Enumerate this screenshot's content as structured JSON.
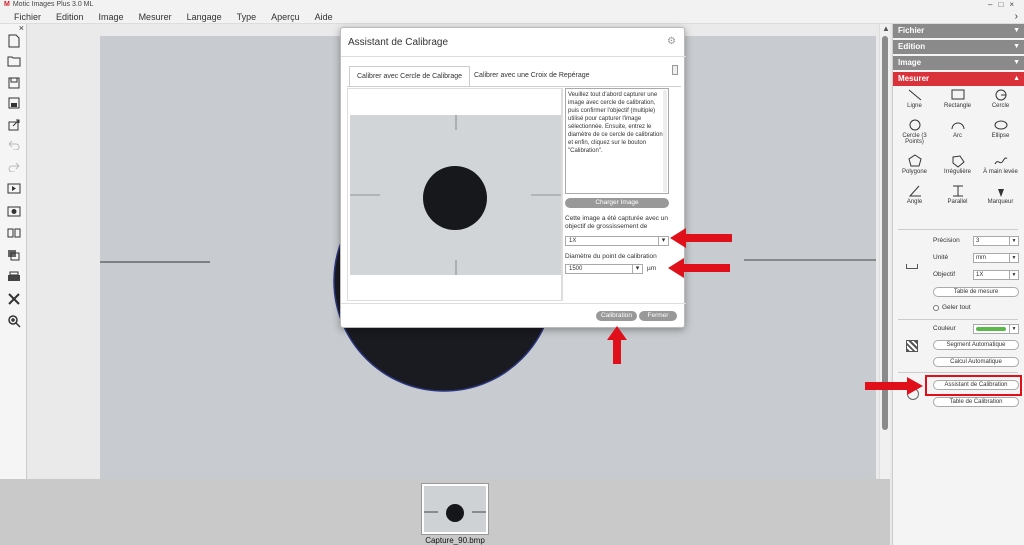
{
  "window": {
    "title": "Motic Images Plus 3.0 ML",
    "controls": "–□×"
  },
  "menu": [
    "Fichier",
    "Edition",
    "Image",
    "Mesurer",
    "Langage",
    "Type",
    "Aperçu",
    "Aide"
  ],
  "panel": {
    "sections": [
      {
        "label": "Fichier"
      },
      {
        "label": "Edition"
      },
      {
        "label": "Image"
      },
      {
        "label": "Mesurer"
      }
    ],
    "tools": [
      "Ligne",
      "Rectangle",
      "Cercle",
      "Cercle (3 Points)",
      "Arc",
      "Ellipse",
      "Polygone",
      "Irrégulière",
      "À main levée",
      "Angle",
      "Parallel",
      "Marqueur"
    ],
    "precision_label": "Précision",
    "precision_value": "3",
    "unit_label": "Unité",
    "unit_value": "mm",
    "objective_label": "Objectif",
    "objective_value": "1X",
    "measure_table": "Table de mesure",
    "freeze_all": "Geler tout",
    "color_label": "Couleur",
    "color_value": "#5bb84a",
    "auto_segment": "Segment Automatique",
    "auto_calc": "Calcul Automatique",
    "calib_assistant": "Assistant de Calibration",
    "calib_table": "Table de Calibration"
  },
  "dialog": {
    "title": "Assistant de Calibrage",
    "tab1": "Calibrer avec Cercle de Calibrage",
    "tab2": "Calibrer avec une Croix de Repérage",
    "instructions": "Veuillez tout d'abord capturer une image avec cercle de calibration, puis confirmer l'objectif (multiple) utilisé pour capturer l'image sélectionnée. Ensuite, entrez le diamètre de ce cercle de calibration et enfin, cliquez sur le bouton \"Calibration\".",
    "load_image": "Charger Image",
    "objective_text": "Cette image a été capturée avec un objectif de grossissement de",
    "objective_value": "1X",
    "diameter_label": "Diamètre du point de calibration",
    "diameter_value": "1500",
    "diameter_unit": "µm",
    "calibrate": "Calibration",
    "close": "Fermer"
  },
  "thumbnail": {
    "label": "Capture_90.bmp"
  },
  "colors": {
    "accent": "#d9323a",
    "arrow": "#e0101a",
    "header": "#8a8a8a"
  }
}
